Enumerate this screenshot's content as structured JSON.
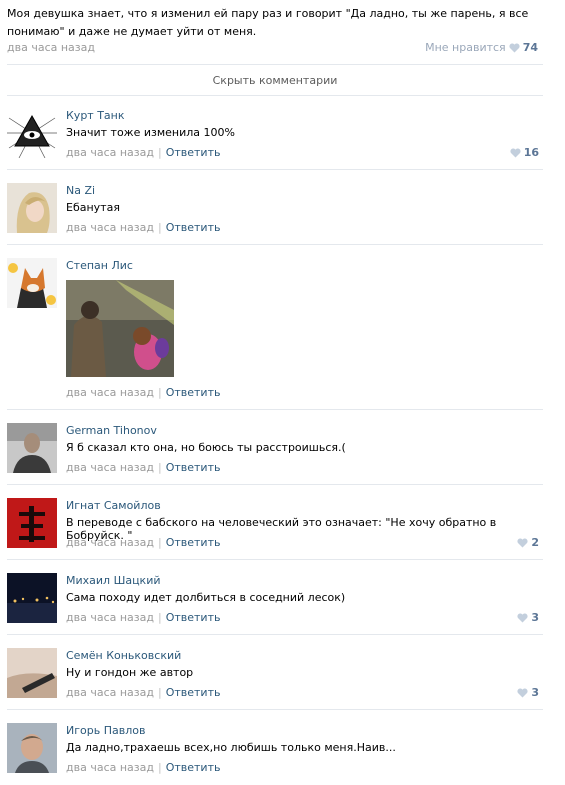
{
  "post": {
    "text": "Моя девушка знает, что я изменил ей пару раз и говорит \"Да ладно, ты же парень, я все понимаю\" и даже не думает уйти от меня.",
    "time": "два часа назад",
    "like_label": "Мне нравится",
    "like_count": "74"
  },
  "hide_comments_label": "Скрыть комментарии",
  "reply_label": "Ответить",
  "comments": [
    {
      "author": "Курт Танк",
      "text": "Значит тоже изменила 100%",
      "time": "два часа назад",
      "likes": "16"
    },
    {
      "author": "Na Zi",
      "text": "Ебанутая",
      "time": "два часа назад",
      "likes": ""
    },
    {
      "author": "Степан Лис",
      "text": "",
      "time": "два часа назад",
      "likes": ""
    },
    {
      "author": "German Tihonov",
      "text": "Я б сказал кто она, но боюсь ты расстроишься.(",
      "time": "два часа назад",
      "likes": ""
    },
    {
      "author": "Игнат Самойлов",
      "text": "В переводе с бабского на человеческий это означает: \"Не хочу обратно в Бобруйск. \"",
      "time": "два часа назад",
      "likes": "2"
    },
    {
      "author": "Михаил Шацкий",
      "text": "Сама походу идет долбиться в соседний лесок)",
      "time": "два часа назад",
      "likes": "3"
    },
    {
      "author": "Семён Коньковский",
      "text": "Ну и гондон же автор",
      "time": "два часа назад",
      "likes": "3"
    },
    {
      "author": "Игорь Павлов",
      "text": "Да ладно,трахаешь всех,но любишь только меня.Наив...",
      "time": "два часа назад",
      "likes": ""
    }
  ],
  "colors": {
    "link": "#2b587a",
    "muted": "#9a9a9a",
    "divider": "#e4e8ed",
    "like": "#9aa7b9"
  },
  "icons": {
    "like": "heart-icon",
    "eye": "all-seeing-eye-icon"
  }
}
